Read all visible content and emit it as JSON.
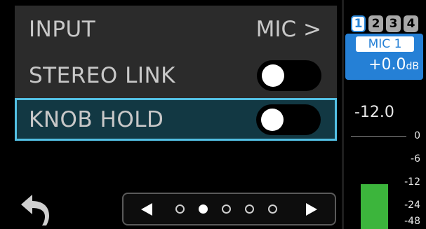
{
  "settings": {
    "input": {
      "label": "INPUT",
      "value": "MIC >"
    },
    "stereo_link": {
      "label": "STEREO LINK",
      "enabled": false
    },
    "knob_hold": {
      "label": "KNOB HOLD",
      "enabled": false,
      "selected": true
    }
  },
  "nav": {
    "back_icon": "back-arrow-icon",
    "pager": {
      "left_icon": "triangle-left",
      "right_icon": "triangle-right",
      "page_count": 5,
      "current_page": 2
    }
  },
  "channel": {
    "tabs": [
      "1",
      "2",
      "3",
      "4"
    ],
    "active_tab": "1",
    "name": "MIC 1",
    "gain_value": "+0.0",
    "gain_unit": "dB"
  },
  "meter": {
    "fader_value": "-12.0",
    "scale": [
      "0",
      "-6",
      "-12",
      "-24",
      "-48"
    ]
  },
  "colors": {
    "accent": "#2580d6",
    "selection_border": "#53c0e4",
    "meter_green": "#3cb53c"
  }
}
